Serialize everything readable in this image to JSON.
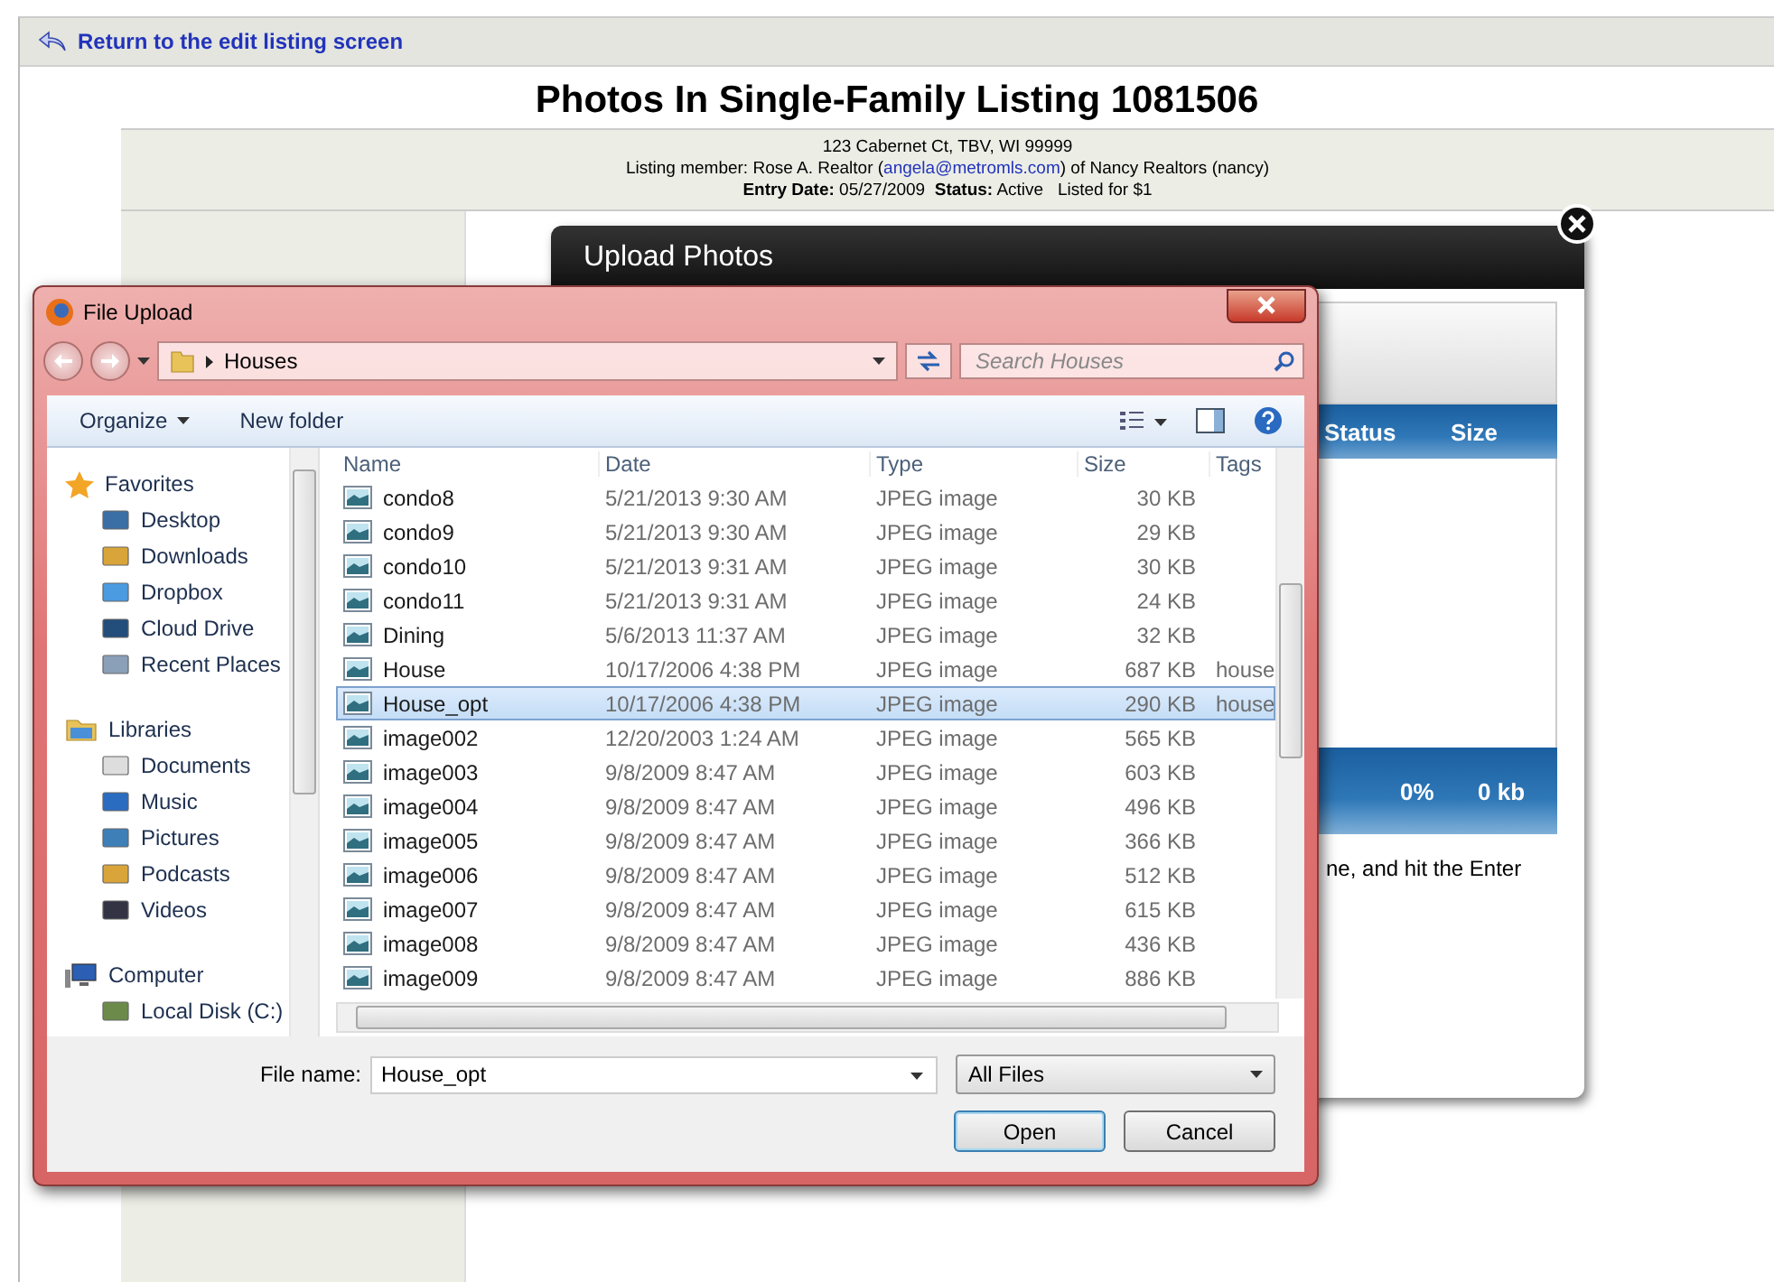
{
  "top_link": "Return to the edit listing screen",
  "title": "Photos In Single-Family Listing 1081506",
  "listing": {
    "address": "123 Cabernet Ct, TBV, WI 99999",
    "member_prefix": "Listing member: Rose A. Realtor (",
    "email": "angela@metromls.com",
    "member_suffix": ") of Nancy Realtors (nancy)",
    "details": "**Entry Date:** 05/27/2009  **Status:** Active   Listed for $1"
  },
  "upload_modal": {
    "title": "Upload Photos",
    "columns": [
      "Status",
      "Size"
    ],
    "progress": [
      "0%",
      "0 kb"
    ],
    "hint": "ne, and hit the Enter"
  },
  "file_dialog": {
    "title": "File Upload",
    "breadcrumb": "Houses",
    "search": {
      "placeholder": "Search Houses"
    },
    "toolbar": [
      "Organize",
      "New folder"
    ],
    "nav": [
      {
        "label": "Favorites",
        "children": [
          {
            "label": "Desktop"
          },
          {
            "label": "Downloads"
          },
          {
            "label": "Dropbox"
          },
          {
            "label": "Cloud Drive"
          },
          {
            "label": "Recent Places"
          }
        ]
      },
      {
        "label": "Libraries",
        "children": [
          {
            "label": "Documents"
          },
          {
            "label": "Music"
          },
          {
            "label": "Pictures"
          },
          {
            "label": "Podcasts"
          },
          {
            "label": "Videos"
          }
        ]
      },
      {
        "label": "Computer",
        "children": [
          {
            "label": "Local Disk (C:)"
          }
        ]
      }
    ],
    "columns": [
      "Name",
      "Date",
      "Type",
      "Size",
      "Tags"
    ],
    "files": [
      {
        "name": "condo8",
        "date": "5/21/2013 9:30 AM",
        "type": "JPEG image",
        "size": "30 KB",
        "selected": false
      },
      {
        "name": "condo9",
        "date": "5/21/2013 9:30 AM",
        "type": "JPEG image",
        "size": "29 KB",
        "selected": false
      },
      {
        "name": "condo10",
        "date": "5/21/2013 9:31 AM",
        "type": "JPEG image",
        "size": "30 KB",
        "selected": false
      },
      {
        "name": "condo11",
        "date": "5/21/2013 9:31 AM",
        "type": "JPEG image",
        "size": "24 KB",
        "selected": false
      },
      {
        "name": "Dining",
        "date": "5/6/2013 11:37 AM",
        "type": "JPEG image",
        "size": "32 KB",
        "selected": false
      },
      {
        "name": "House",
        "date": "10/17/2006 4:38 PM",
        "type": "JPEG image",
        "size": "687 KB",
        "tags": "house",
        "selected": false
      },
      {
        "name": "House_opt",
        "date": "10/17/2006 4:38 PM",
        "type": "JPEG image",
        "size": "290 KB",
        "tags": "house",
        "selected": true
      },
      {
        "name": "image002",
        "date": "12/20/2003 1:24 AM",
        "type": "JPEG image",
        "size": "565 KB",
        "selected": false
      },
      {
        "name": "image003",
        "date": "9/8/2009 8:47 AM",
        "type": "JPEG image",
        "size": "603 KB",
        "selected": false
      },
      {
        "name": "image004",
        "date": "9/8/2009 8:47 AM",
        "type": "JPEG image",
        "size": "496 KB",
        "selected": false
      },
      {
        "name": "image005",
        "date": "9/8/2009 8:47 AM",
        "type": "JPEG image",
        "size": "366 KB",
        "selected": false
      },
      {
        "name": "image006",
        "date": "9/8/2009 8:47 AM",
        "type": "JPEG image",
        "size": "512 KB",
        "selected": false
      },
      {
        "name": "image007",
        "date": "9/8/2009 8:47 AM",
        "type": "JPEG image",
        "size": "615 KB",
        "selected": false
      },
      {
        "name": "image008",
        "date": "9/8/2009 8:47 AM",
        "type": "JPEG image",
        "size": "436 KB",
        "selected": false
      },
      {
        "name": "image009",
        "date": "9/8/2009 8:47 AM",
        "type": "JPEG image",
        "size": "886 KB",
        "selected": false
      }
    ],
    "file_name": {
      "label": "File name:",
      "value": "House_opt"
    },
    "file_type": "All Files",
    "buttons": [
      "Open",
      "Cancel"
    ]
  }
}
